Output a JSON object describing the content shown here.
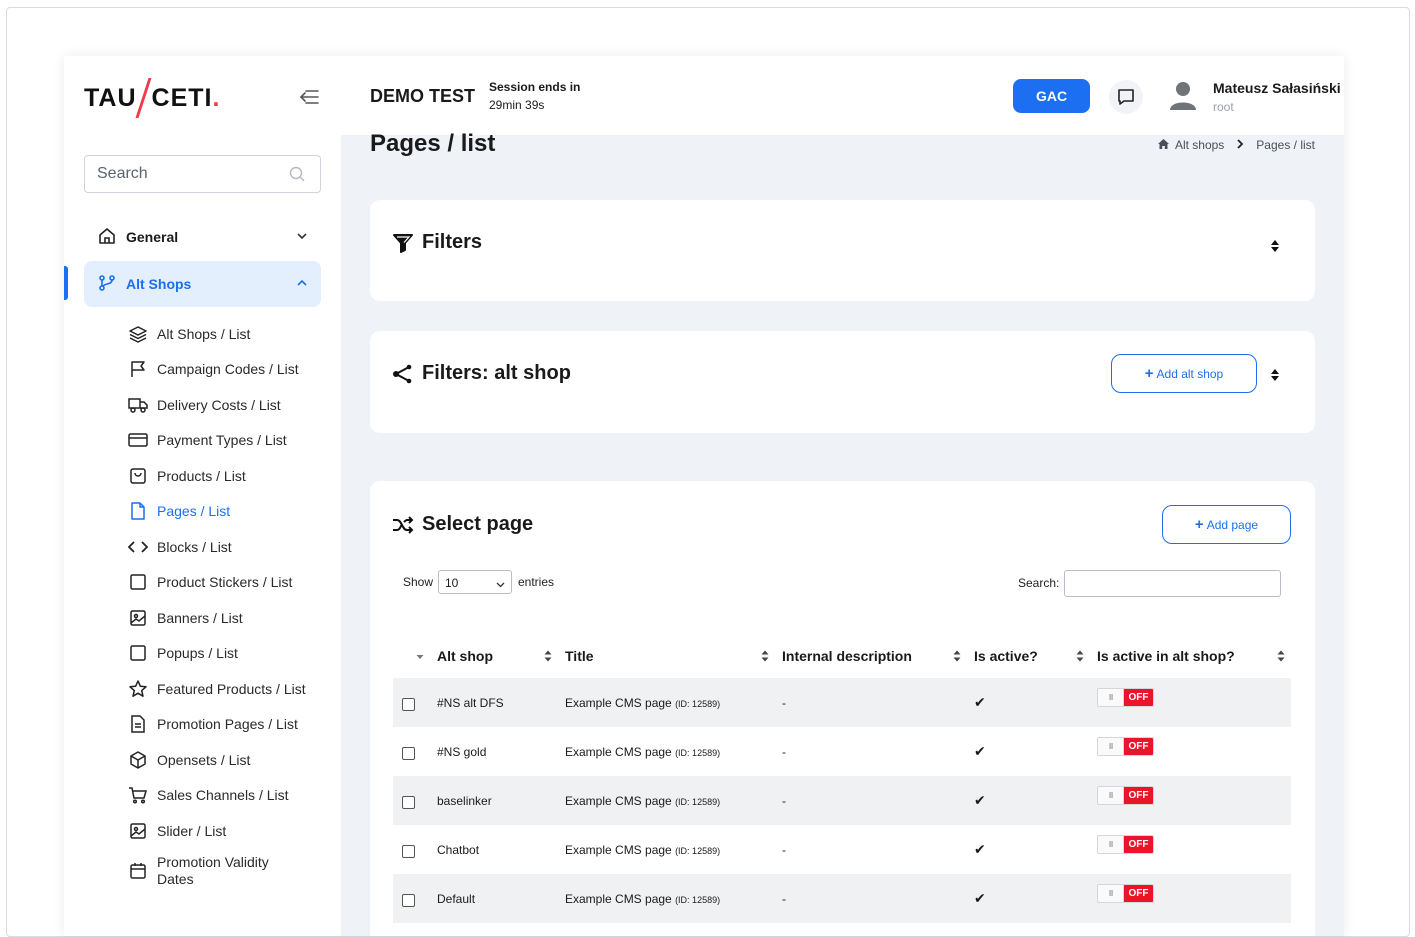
{
  "logo": {
    "left": "TAU",
    "right": "CETI",
    "dot": "."
  },
  "sidebar": {
    "search_placeholder": "Search",
    "general_label": "General",
    "alt_shops_label": "Alt Shops",
    "items": [
      {
        "label": "Alt Shops / List",
        "icon": "layers-icon"
      },
      {
        "label": "Campaign Codes / List",
        "icon": "flag-icon"
      },
      {
        "label": "Delivery Costs / List",
        "icon": "truck-icon"
      },
      {
        "label": "Payment Types / List",
        "icon": "credit-card-icon"
      },
      {
        "label": "Products / List",
        "icon": "shopping-bag-icon"
      },
      {
        "label": "Pages / List",
        "icon": "file-icon",
        "active": true
      },
      {
        "label": "Blocks / List",
        "icon": "code-icon"
      },
      {
        "label": "Product Stickers / List",
        "icon": "square-icon"
      },
      {
        "label": "Banners / List",
        "icon": "image-icon"
      },
      {
        "label": "Popups / List",
        "icon": "square-icon"
      },
      {
        "label": "Featured Products / List",
        "icon": "star-icon"
      },
      {
        "label": "Promotion Pages / List",
        "icon": "file-text-icon"
      },
      {
        "label": "Opensets / List",
        "icon": "box-icon"
      },
      {
        "label": "Sales Channels / List",
        "icon": "cart-icon"
      },
      {
        "label": "Slider / List",
        "icon": "image-icon"
      },
      {
        "label": "Promotion Validity Dates",
        "icon": "calendar-icon"
      }
    ]
  },
  "header": {
    "title": "DEMO TEST",
    "session_label": "Session ends in",
    "session_time": "29min 39s",
    "gac_label": "GAC",
    "user_name": "Mateusz Sałasiński",
    "user_role": "root"
  },
  "page": {
    "title": "Pages / list",
    "breadcrumb": {
      "home": "Alt shops",
      "current": "Pages / list"
    }
  },
  "filters_card": {
    "title": "Filters"
  },
  "alt_shop_card": {
    "title": "Filters: alt shop",
    "add_label": "Add alt shop"
  },
  "select_card": {
    "title": "Select page",
    "add_label": "Add page",
    "show_label": "Show",
    "show_value": "10",
    "entries_label": "entries",
    "search_label": "Search:"
  },
  "table": {
    "columns": [
      "Alt shop",
      "Title",
      "Internal description",
      "Is active?",
      "Is active in alt shop?"
    ],
    "rows": [
      {
        "alt_shop": "#NS alt DFS",
        "title": "Example CMS page",
        "id": "(ID: 12589)",
        "description": "-",
        "active": "✔",
        "alt_active": "OFF",
        "knob": "III"
      },
      {
        "alt_shop": "#NS gold",
        "title": "Example CMS page",
        "id": "(ID: 12589)",
        "description": "-",
        "active": "✔",
        "alt_active": "OFF",
        "knob": "III"
      },
      {
        "alt_shop": "baselinker",
        "title": "Example CMS page",
        "id": "(ID: 12589)",
        "description": "-",
        "active": "✔",
        "alt_active": "OFF",
        "knob": "III"
      },
      {
        "alt_shop": "Chatbot",
        "title": "Example CMS page",
        "id": "(ID: 12589)",
        "description": "-",
        "active": "✔",
        "alt_active": "OFF",
        "knob": "III"
      },
      {
        "alt_shop": "Default",
        "title": "Example CMS page",
        "id": "(ID: 12589)",
        "description": "-",
        "active": "✔",
        "alt_active": "OFF",
        "knob": "III"
      }
    ]
  },
  "colors": {
    "accent": "#1c6ff0",
    "brand_red": "#ef3b4b",
    "off_red": "#e8152b",
    "background": "#eff2f7"
  }
}
